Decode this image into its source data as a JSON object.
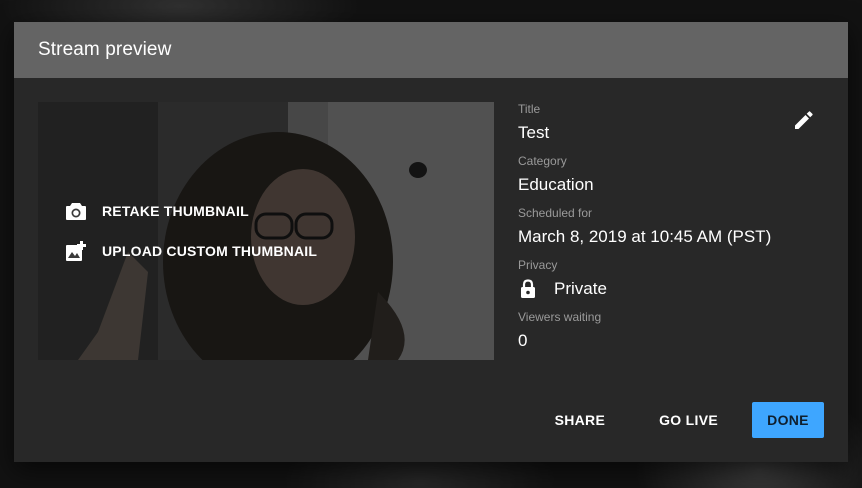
{
  "dialog": {
    "title": "Stream preview"
  },
  "thumbnail": {
    "retake_label": "RETAKE THUMBNAIL",
    "upload_label": "UPLOAD CUSTOM THUMBNAIL",
    "retake_icon": "camera-icon",
    "upload_icon": "add-photo-icon"
  },
  "details": {
    "title_label": "Title",
    "title_value": "Test",
    "category_label": "Category",
    "category_value": "Education",
    "scheduled_label": "Scheduled for",
    "scheduled_value": "March 8, 2019 at 10:45 AM (PST)",
    "privacy_label": "Privacy",
    "privacy_value": "Private",
    "privacy_icon": "lock-icon",
    "viewers_label": "Viewers waiting",
    "viewers_value": "0",
    "edit_icon": "pencil-icon"
  },
  "actions": {
    "share_label": "SHARE",
    "golive_label": "GO LIVE",
    "done_label": "DONE"
  },
  "colors": {
    "dialog_bg": "#282828",
    "header_bg": "#646464",
    "accent": "#3ea6ff",
    "label_text": "#9a9a9a"
  }
}
